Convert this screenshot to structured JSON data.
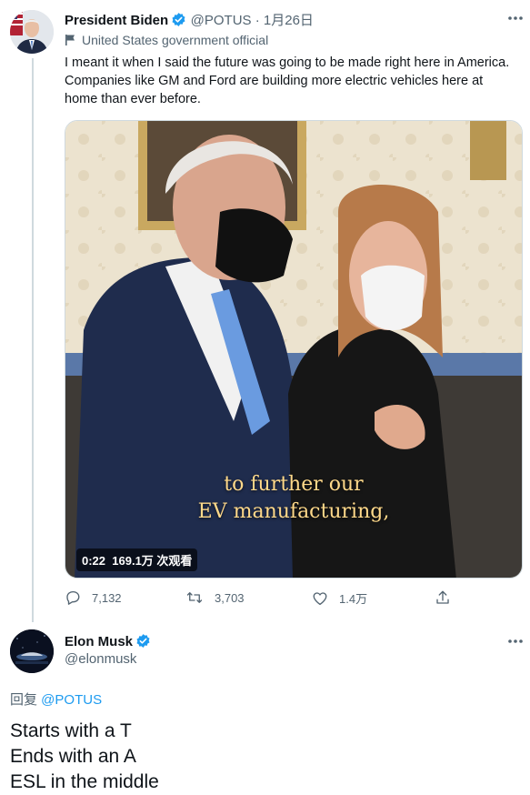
{
  "tweet1": {
    "author_name": "President Biden",
    "handle": "@POTUS",
    "separator": " · ",
    "date": "1月26日",
    "account_label": "United States government official",
    "text": "I meant it when I said the future was going to be made right here in America. Companies like GM and Ford are building more electric vehicles here at home than ever before.",
    "video": {
      "caption_line1": "to further our",
      "caption_line2": "EV manufacturing,",
      "duration": "0:22",
      "views": "169.1万 次观看"
    },
    "actions": {
      "replies": "7,132",
      "retweets": "3,703",
      "likes": "1.4万"
    }
  },
  "tweet2": {
    "author_name": "Elon Musk",
    "handle": "@elonmusk",
    "reply_prefix": "回复 ",
    "reply_to": "@POTUS",
    "lines": [
      "Starts with a T",
      "Ends with an A",
      "ESL in the middle"
    ]
  },
  "colors": {
    "verified": "#1d9bf0",
    "link": "#1d9bf0",
    "muted": "#536471",
    "caption": "#ffd98a"
  },
  "icons": {
    "verified": "verified-badge-icon",
    "label": "flag-icon",
    "more": "more-horizontal-icon",
    "reply": "reply-icon",
    "retweet": "retweet-icon",
    "like": "heart-icon",
    "share": "share-icon"
  }
}
